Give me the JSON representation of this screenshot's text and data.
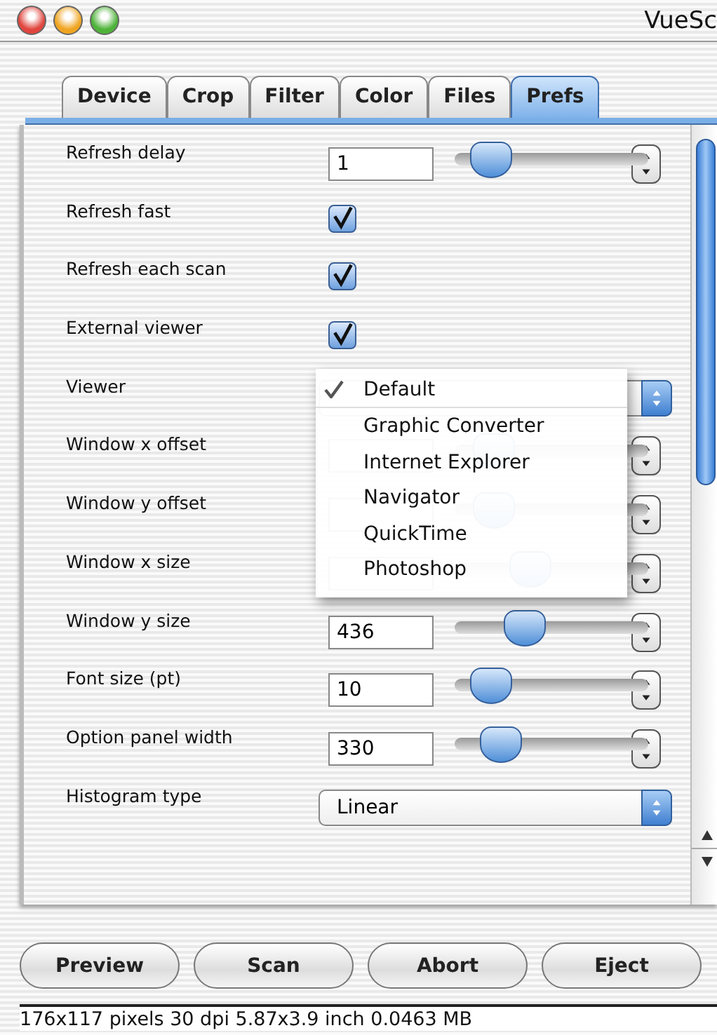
{
  "window": {
    "title": "VueSc"
  },
  "tabs": [
    {
      "label": "Device",
      "selected": false
    },
    {
      "label": "Crop",
      "selected": false
    },
    {
      "label": "Filter",
      "selected": false
    },
    {
      "label": "Color",
      "selected": false
    },
    {
      "label": "Files",
      "selected": false
    },
    {
      "label": "Prefs",
      "selected": true
    }
  ],
  "settings": [
    {
      "kind": "slider",
      "label": "Refresh delay",
      "value": "1",
      "level": 0.1
    },
    {
      "kind": "checkbox",
      "label": "Refresh fast",
      "checked": true
    },
    {
      "kind": "checkbox",
      "label": "Refresh each scan",
      "checked": true
    },
    {
      "kind": "checkbox",
      "label": "External viewer",
      "checked": true
    },
    {
      "kind": "popup",
      "label": "Viewer",
      "open": true
    },
    {
      "kind": "slider",
      "label": "Window x offset",
      "level": 0.12
    },
    {
      "kind": "slider",
      "label": "Window y offset",
      "level": 0.12
    },
    {
      "kind": "slider",
      "label": "Window x size",
      "level": 0.36
    },
    {
      "kind": "slider",
      "label": "Window y size",
      "value": "436",
      "level": 0.32
    },
    {
      "kind": "slider",
      "label": "Font size (pt)",
      "value": "10",
      "level": 0.1
    },
    {
      "kind": "slider",
      "label": "Option panel width",
      "value": "330",
      "level": 0.17
    },
    {
      "kind": "popup",
      "label": "Histogram type",
      "value": "Linear",
      "open": false
    }
  ],
  "viewer_menu": [
    {
      "label": "Default",
      "selected": true
    },
    {
      "label": "Graphic Converter",
      "selected": false
    },
    {
      "label": "Internet Explorer",
      "selected": false
    },
    {
      "label": "Navigator",
      "selected": false
    },
    {
      "label": "QuickTime",
      "selected": false
    },
    {
      "label": "Photoshop",
      "selected": false
    }
  ],
  "buttons": [
    "Preview",
    "Scan",
    "Abort",
    "Eject"
  ],
  "status_bar": "176x117 pixels 30 dpi 5.87x3.9 inch 0.0463 MB"
}
